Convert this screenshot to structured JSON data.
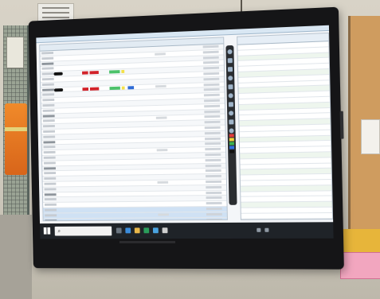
{
  "scene": {
    "pink_label_text": "",
    "tray_time_line1": "",
    "tray_time_line2": ""
  },
  "colors": {
    "wall": "#d8d3c7",
    "bezel": "#151517",
    "screen": "#f4f6f9",
    "accent_red": "#d2232a",
    "accent_green": "#4cc26a",
    "accent_yellow": "#f3e04a",
    "accent_blue": "#2e6bd6"
  },
  "icons": {
    "start": "windows-start-icon",
    "search": "search-icon"
  }
}
